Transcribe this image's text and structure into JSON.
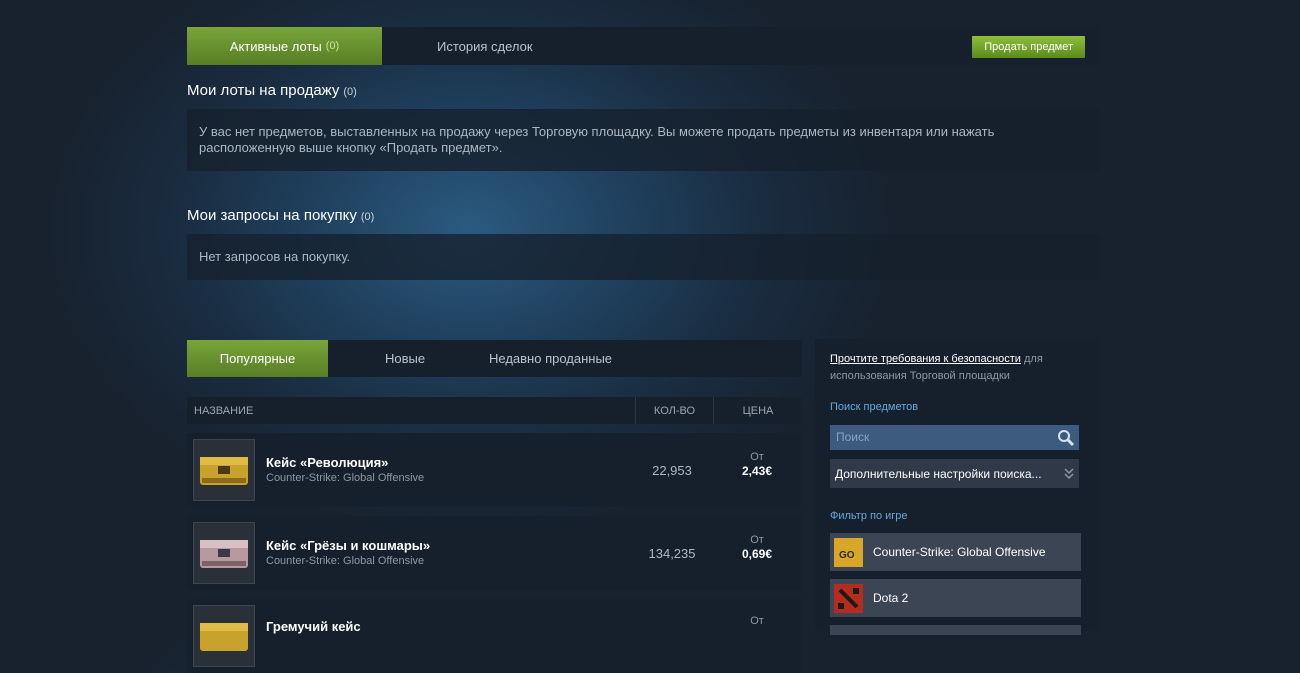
{
  "tabs": {
    "active_label": "Активные лоты",
    "active_count": "(0)",
    "history_label": "История сделок",
    "sell_button": "Продать предмет"
  },
  "listings": {
    "title": "Мои лоты на продажу",
    "count": "(0)",
    "empty_text": "У вас нет предметов, выставленных на продажу через Торговую площадку. Вы можете продать предметы из инвентаря или нажать расположенную выше кнопку «Продать предмет»."
  },
  "buy_orders": {
    "title": "Мои запросы на покупку",
    "count": "(0)",
    "empty_text": "Нет запросов на покупку."
  },
  "market_tabs": [
    "Популярные",
    "Новые",
    "Недавно проданные"
  ],
  "table": {
    "headers": [
      "НАЗВАНИЕ",
      "КОЛ-ВО",
      "ЦЕНА"
    ],
    "rows": [
      {
        "name": "Кейс «Революция»",
        "game": "Counter-Strike: Global Offensive",
        "qty": "22,953",
        "from": "От",
        "price": "2,43€",
        "color": "#c9a22d"
      },
      {
        "name": "Кейс «Грёзы и кошмары»",
        "game": "Counter-Strike: Global Offensive",
        "qty": "134,235",
        "from": "От",
        "price": "0,69€",
        "color": "#b89a9e"
      },
      {
        "name": "Гремучий кейс",
        "game": "",
        "qty": "",
        "from": "От",
        "price": "",
        "color": "#c9a22d"
      }
    ]
  },
  "sidebar": {
    "security_link": "Прочтите требования к безопасности",
    "security_rest": " для использования Торговой площадки",
    "search_label": "Поиск предметов",
    "search_placeholder": "Поиск",
    "advanced_label": "Дополнительные настройки поиска...",
    "filter_label": "Фильтр по игре",
    "games": [
      {
        "name": "Counter-Strike: Global Offensive",
        "icon": "csgo-icon"
      },
      {
        "name": "Dota 2",
        "icon": "dota2-icon"
      }
    ]
  },
  "colors": {
    "accent_green": "#79a53a",
    "link_blue": "#66a8e0"
  }
}
